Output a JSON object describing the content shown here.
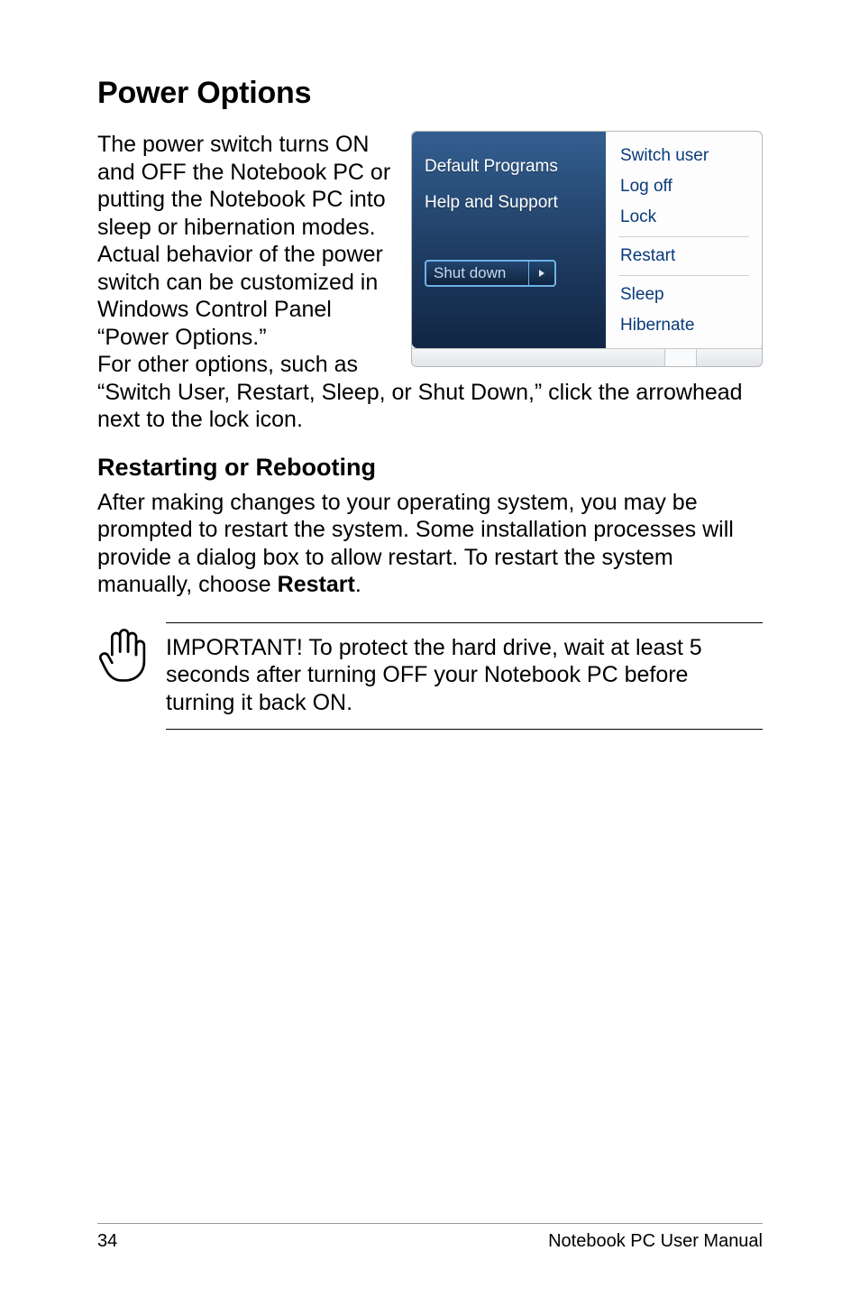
{
  "heading": "Power Options",
  "para1_left": "The power switch turns ON and OFF the Notebook PC or putting the Notebook PC into sleep or hibernation modes. Actual behavior of the power switch can be customized in Windows Control Panel “Power Options.”",
  "para1_below": "For other options, such as “Switch User, Restart, Sleep, or Shut Down,” click the arrowhead next to the lock icon.",
  "subhead": "Restarting or Rebooting",
  "para2_a": "After making changes to your operating system, you may be prompted to restart the system. Some installation processes will provide a dialog box to allow restart. To restart the system manually, choose ",
  "para2_bold": "Restart",
  "para2_b": ".",
  "callout": "IMPORTANT!  To protect the hard drive, wait at least 5 seconds after turning OFF your Notebook PC before turning it back ON.",
  "screenshot": {
    "left_items": [
      "Default Programs",
      "Help and Support"
    ],
    "shutdown_label": "Shut down",
    "right_items_top": [
      "Switch user",
      "Log off",
      "Lock"
    ],
    "right_items_mid": [
      "Restart"
    ],
    "right_items_bot": [
      "Sleep",
      "Hibernate"
    ]
  },
  "footer": {
    "page": "34",
    "title": "Notebook PC User Manual"
  }
}
